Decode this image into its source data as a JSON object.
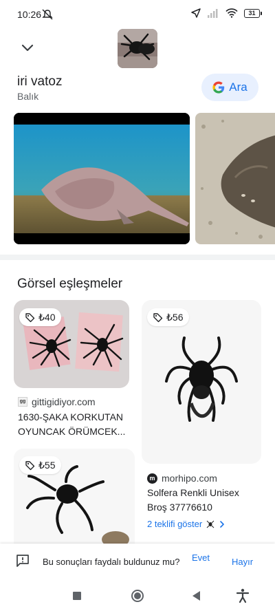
{
  "status": {
    "time": "10:26",
    "battery": "31"
  },
  "entity": {
    "title": "iri vatoz",
    "subtitle": "Balık",
    "search_label": "Ara"
  },
  "section": {
    "title": "Görsel eşleşmeler"
  },
  "results": [
    {
      "price": "₺40",
      "source": "gittigidiyor.com",
      "source_badge": "gg",
      "title": "1630-ŞAKA KORKUTAN OYUNCAK ÖRÜMCEK..."
    },
    {
      "price": "₺56",
      "source": "morhipo.com",
      "source_badge": "m",
      "title": "Solfera Renkli Unisex Broş 37776610",
      "offers": "2 teklifi göster"
    },
    {
      "price": "₺55"
    }
  ],
  "feedback": {
    "question": "Bu sonuçları faydalı buldunuz mu?",
    "yes": "Evet",
    "no": "Hayır"
  },
  "icons": {
    "collapse": "chevron-down-icon",
    "google": "google-logo-icon",
    "tag": "price-tag-icon",
    "feedback": "feedback-icon",
    "nav_recents": "square-icon",
    "nav_home": "circle-icon",
    "nav_back": "triangle-back-icon",
    "nav_accessibility": "accessibility-icon"
  },
  "colors": {
    "accent": "#1a73e8",
    "accent_bg": "#e8f0fe",
    "text": "#202124",
    "secondary": "#5f6368"
  }
}
